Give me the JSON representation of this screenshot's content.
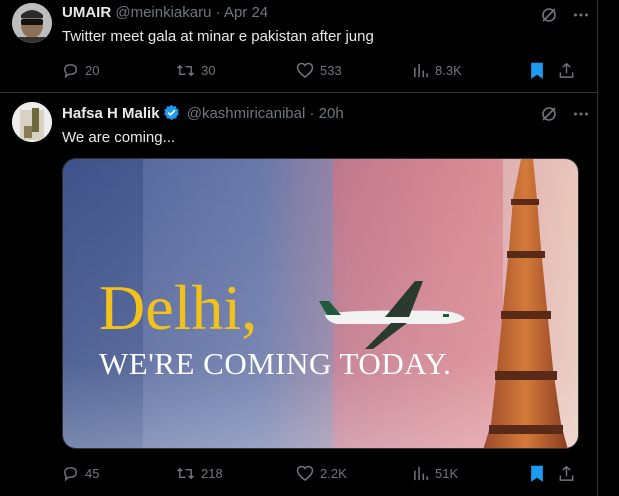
{
  "colors": {
    "background": "#000000",
    "text_primary": "#e7e9ea",
    "text_secondary": "#71767b",
    "accent": "#1d9bf0",
    "divider": "#2f3336",
    "headline_yellow": "#f2c21b"
  },
  "tweets": [
    {
      "name": "UMAIR",
      "handle": "@meinkiakaru",
      "separator": "·",
      "time": "Apr 24",
      "verified": false,
      "text": "Twitter meet gala at minar e pakistan after jung",
      "stats": {
        "replies": "20",
        "retweets": "30",
        "likes": "533",
        "views": "8.3K"
      },
      "bookmarked": true
    },
    {
      "name": "Hafsa H Malik",
      "handle": "@kashmiricanibal",
      "separator": "·",
      "time": "20h",
      "verified": true,
      "text": "We are coming...",
      "media": {
        "headline": "Delhi,",
        "subline": "WE'RE COMING TODAY."
      },
      "stats": {
        "replies": "45",
        "retweets": "218",
        "likes": "2.2K",
        "views": "51K"
      },
      "bookmarked": true
    }
  ],
  "icons": {
    "grok": "grok-icon",
    "more": "more-icon",
    "reply": "reply-icon",
    "retweet": "retweet-icon",
    "like": "like-icon",
    "views": "views-icon",
    "bookmark": "bookmark-icon",
    "share": "share-icon"
  }
}
